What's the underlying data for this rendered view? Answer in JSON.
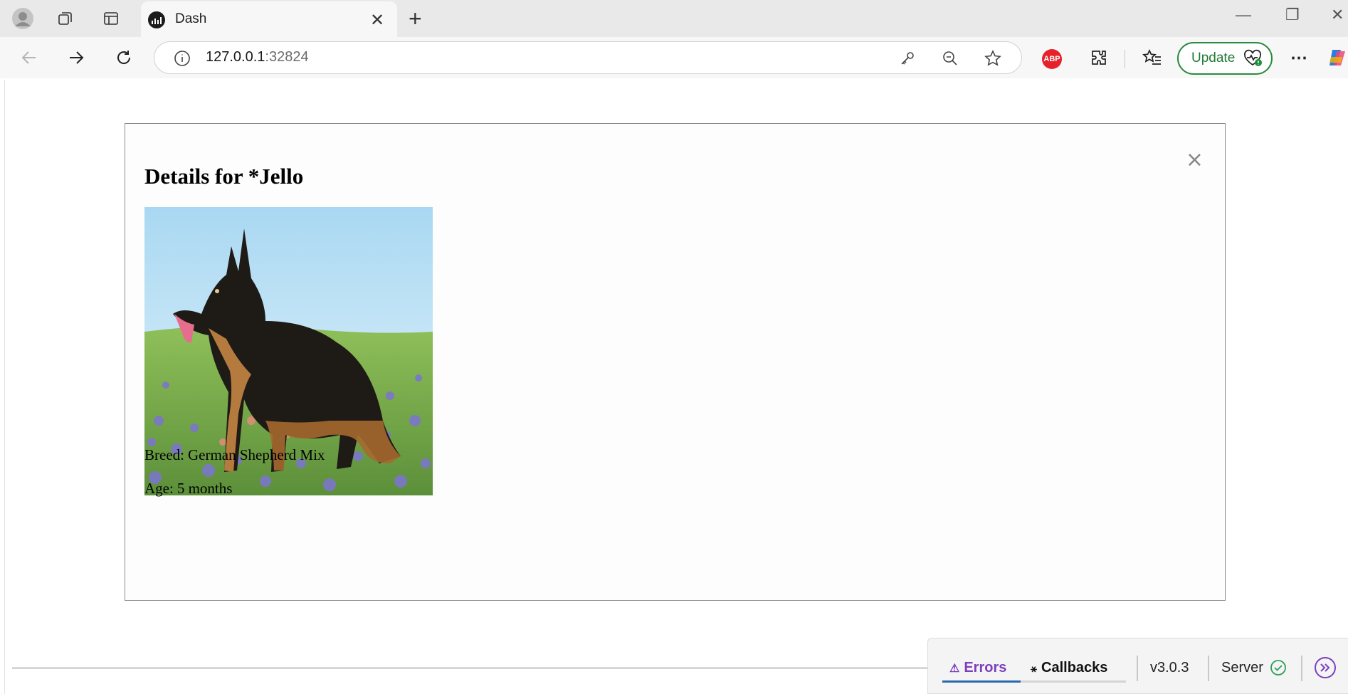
{
  "browser": {
    "tab": {
      "title": "Dash"
    },
    "url": {
      "host": "127.0.0.1",
      "port": ":32824"
    },
    "update_label": "Update",
    "abp_label": "ABP"
  },
  "modal": {
    "title": "Details for *Jello",
    "close_glyph": "×",
    "breed_label": "Breed:",
    "breed_value": "German Shepherd Mix",
    "age_label": "Age:",
    "age_value": "5 months"
  },
  "devtools": {
    "errors_label": "Errors",
    "callbacks_label": "Callbacks",
    "version": "v3.0.3",
    "server_label": "Server",
    "accent_color": "#7b3fbf"
  }
}
